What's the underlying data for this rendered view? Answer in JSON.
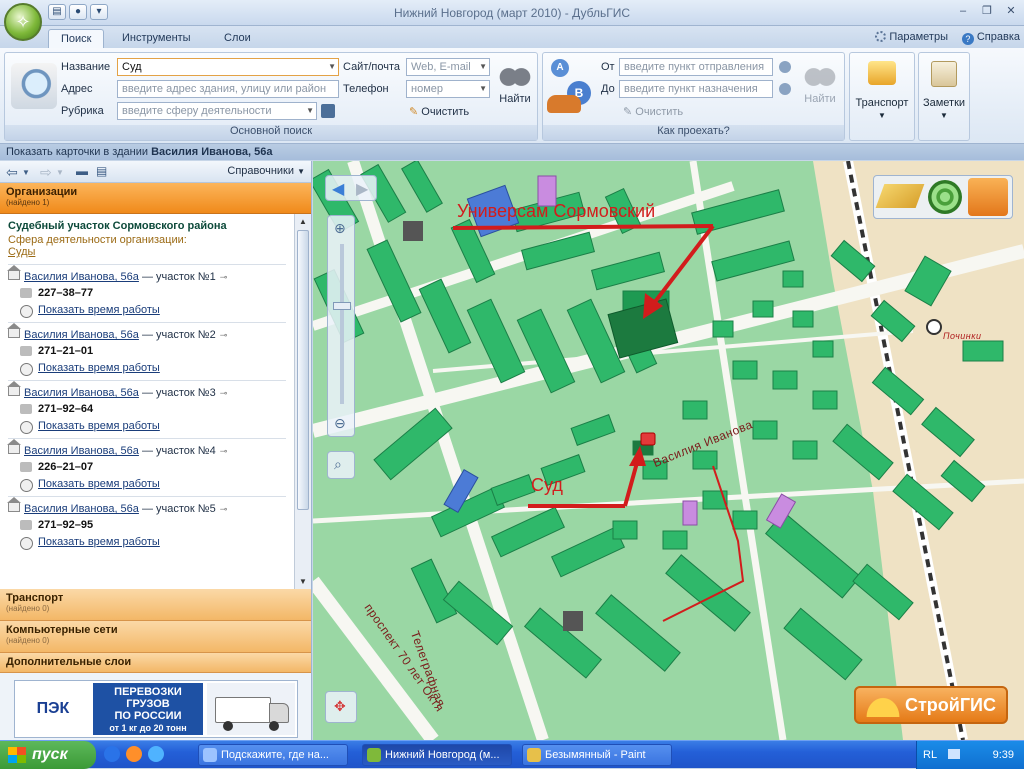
{
  "window": {
    "title": "Нижний Новгород (март 2010) - ДубльГИС"
  },
  "tabs": [
    {
      "label": "Поиск",
      "active": true
    },
    {
      "label": "Инструменты"
    },
    {
      "label": "Слои"
    }
  ],
  "topright": {
    "params": "Параметры",
    "help": "Справка"
  },
  "ribbon": {
    "search": {
      "name_label": "Название",
      "name_value": "Суд",
      "address_label": "Адрес",
      "address_placeholder": "введите адрес здания, улицу или район",
      "rubric_label": "Рубрика",
      "rubric_placeholder": "введите сферу деятельности",
      "site_label": "Сайт/почта",
      "site_placeholder": "Web, E-mail",
      "phone_label": "Телефон",
      "phone_placeholder": "номер",
      "find_label": "Найти",
      "clear_label": "Очистить",
      "group_label": "Основной поиск"
    },
    "route": {
      "from_label": "От",
      "from_placeholder": "введите пункт отправления",
      "to_label": "До",
      "to_placeholder": "введите пункт назначения",
      "clear_label": "Очистить",
      "find_label": "Найти",
      "group_label": "Как проехать?",
      "badge_a": "A",
      "badge_b": "B"
    },
    "transport_label": "Транспорт",
    "notes_label": "Заметки"
  },
  "strip": {
    "prefix": "Показать карточки в здании",
    "address": "Василия Иванова, 56а"
  },
  "leftpanel": {
    "directories_label": "Справочники",
    "orgs_section": {
      "title": "Организации",
      "sub": "(найдено 1)"
    },
    "org": {
      "name": "Судебный участок Сормовского района",
      "sphere_label": "Сфера деятельности организации:",
      "sphere_link": "Суды"
    },
    "entries": [
      {
        "addr": "Василия Иванова, 56а",
        "suffix": " — участок №1",
        "phone": "227–38–77",
        "hours": "Показать время работы"
      },
      {
        "addr": "Василия Иванова, 56а",
        "suffix": " — участок №2",
        "phone": "271–21–01",
        "hours": "Показать время работы"
      },
      {
        "addr": "Василия Иванова, 56а",
        "suffix": " — участок №3",
        "phone": "271–92–64",
        "hours": "Показать время работы"
      },
      {
        "addr": "Василия Иванова, 56а",
        "suffix": " — участок №4",
        "phone": "226–21–07",
        "hours": "Показать время работы"
      },
      {
        "addr": "Василия Иванова, 56а",
        "suffix": " — участок №5",
        "phone": "271–92–95",
        "hours": "Показать время работы"
      }
    ],
    "sections": [
      {
        "title": "Транспорт",
        "sub": "(найдено 0)"
      },
      {
        "title": "Компьютерные сети",
        "sub": "(найдено 0)"
      },
      {
        "title": "Дополнительные слои"
      }
    ],
    "ad": {
      "logo": "ПЭК",
      "line1": "ПЕРЕВОЗКИ",
      "line2": "ГРУЗОВ",
      "line3": "ПО РОССИИ",
      "line4": "от 1 кг до 20 тонн"
    }
  },
  "map": {
    "annotation_top": "Универсам Сормовский",
    "annotation_court": "Суд",
    "street_ivanova": "Василия Иванова",
    "street_telegraph": "Телеграфная",
    "street_prospect": "проспект 70 лет Октя",
    "station": "Починки",
    "stroigis": "СтройГИС"
  },
  "taskbar": {
    "start": "пуск",
    "tasks": [
      {
        "label": "Подскажите, где на...",
        "active": false
      },
      {
        "label": "Нижний Новгород (м...",
        "active": true
      },
      {
        "label": "Безымянный - Paint",
        "active": false
      }
    ],
    "lang": "RL",
    "clock": "9:39"
  },
  "colors": {
    "map_green": "#9ad7a4",
    "building_green": "#2fb86a",
    "road": "#f4f4ee",
    "annotation_red": "#d21c1c",
    "section_orange": "#f08a1a"
  }
}
